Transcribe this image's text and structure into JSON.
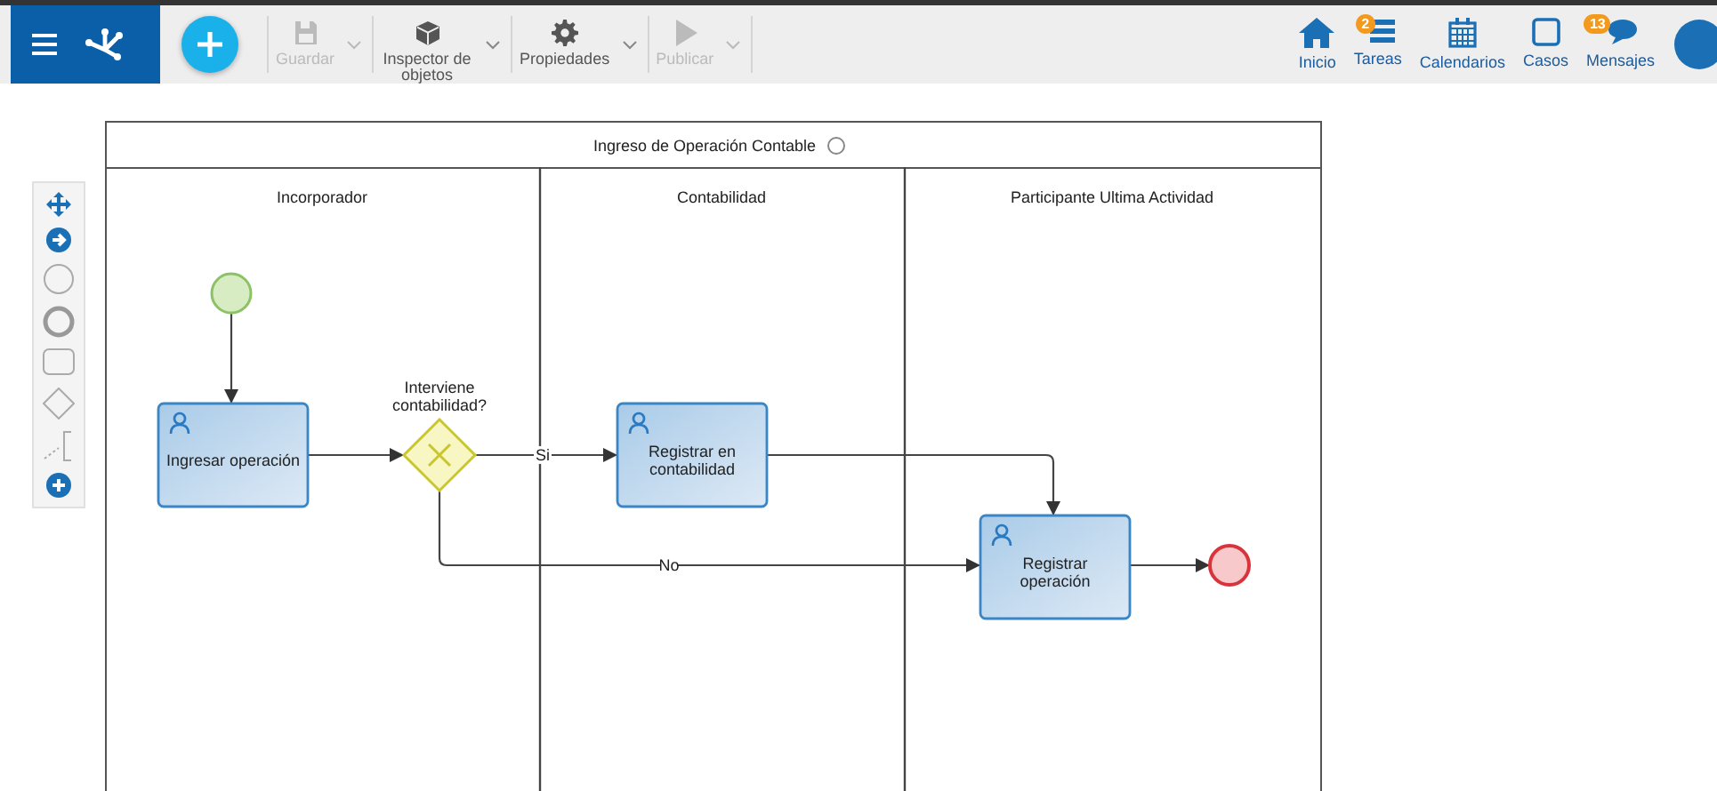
{
  "toolbar": {
    "tools": [
      {
        "kind": "save",
        "label": "Guardar",
        "disabled": true
      },
      {
        "kind": "inspector",
        "label": "Inspector de objetos",
        "disabled": false
      },
      {
        "kind": "properties",
        "label": "Propiedades",
        "disabled": false
      },
      {
        "kind": "publish",
        "label": "Publicar",
        "disabled": true
      }
    ],
    "nav": [
      {
        "kind": "home",
        "label": "Inicio"
      },
      {
        "kind": "tasks",
        "label": "Tareas",
        "badge": "2"
      },
      {
        "kind": "calendar",
        "label": "Calendarios"
      },
      {
        "kind": "cases",
        "label": "Casos"
      },
      {
        "kind": "messages",
        "label": "Mensajes",
        "badge": "13"
      }
    ]
  },
  "diagram": {
    "pool_title": "Ingreso de Operación Contable",
    "lanes": [
      "Incorporador",
      "Contabilidad",
      "Participante Ultima Actividad"
    ],
    "nodes": [
      {
        "kind": "start"
      },
      {
        "kind": "task",
        "label": "Ingresar operación"
      },
      {
        "kind": "gateway",
        "label": "Interviene contabilidad?"
      },
      {
        "kind": "task",
        "label": "Registrar en contabilidad"
      },
      {
        "kind": "task",
        "label": "Registrar operación"
      },
      {
        "kind": "end"
      }
    ],
    "flow_labels": [
      "Si",
      "No"
    ]
  }
}
